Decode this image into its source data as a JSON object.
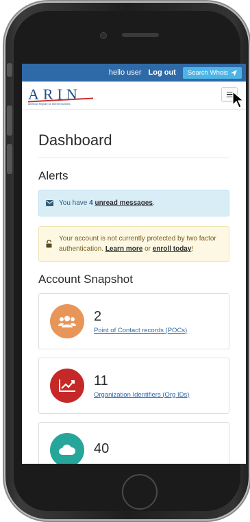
{
  "topbar": {
    "greeting": "hello user",
    "logout": "Log out",
    "search": "Search Whois"
  },
  "header": {
    "logo_text": "ARIN",
    "logo_subtitle": "American Registry for Internet Numbers"
  },
  "page": {
    "title": "Dashboard"
  },
  "alerts": {
    "heading": "Alerts",
    "messages": {
      "prefix": "You have ",
      "count": "4",
      "link": "unread messages",
      "suffix": "."
    },
    "security": {
      "text": "Your account is not currently protected by two factor authentication. ",
      "learn_more": "Learn more",
      "or": " or ",
      "enroll": "enroll today",
      "suffix": "!"
    }
  },
  "snapshot": {
    "heading": "Account Snapshot",
    "cards": [
      {
        "value": "2",
        "label": "Point of Contact records (POCs)",
        "color": "#e8955a"
      },
      {
        "value": "11",
        "label": "Organization Identifiers (Org IDs)",
        "color": "#c62828"
      },
      {
        "value": "40",
        "label": "",
        "color": "#26a69a"
      }
    ]
  },
  "colors": {
    "topbar": "#2f6aa8",
    "search_button": "#4eb3e6",
    "info_alert": "#d9edf7",
    "warning_alert": "#fcf8e3"
  }
}
